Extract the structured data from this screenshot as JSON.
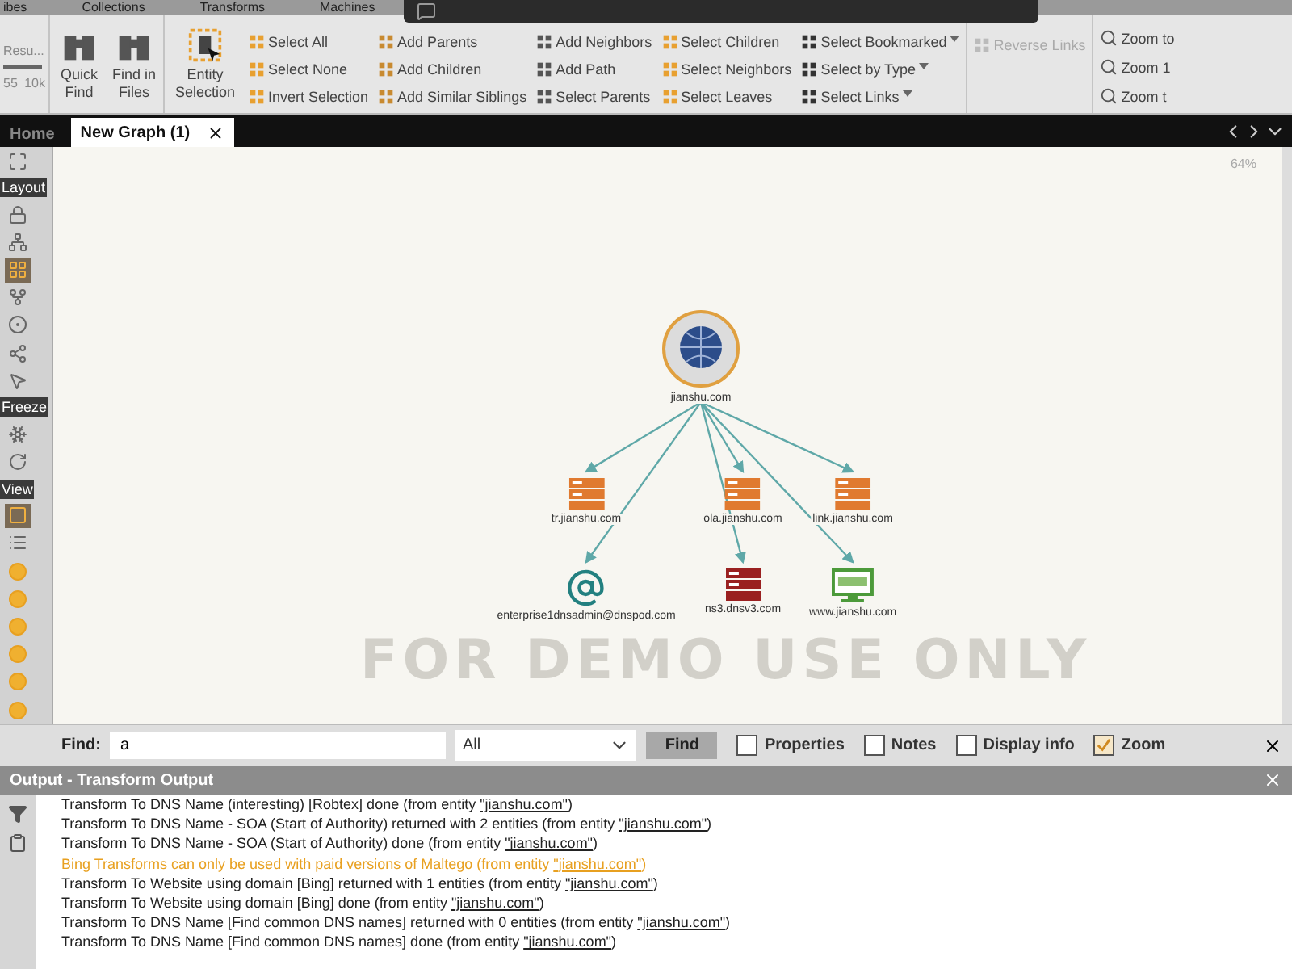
{
  "menu_tabs": [
    "ibes",
    "Collections",
    "Transforms",
    "Machines"
  ],
  "ribbon": {
    "slider_label": "Resu...",
    "ticks": [
      "55",
      "10k"
    ],
    "big_buttons": [
      {
        "label": "Quick Find"
      },
      {
        "label": "Find in Files"
      },
      {
        "label": "Entity Selection"
      }
    ],
    "columns": [
      {
        "items": [
          {
            "label": "Select All"
          },
          {
            "label": "Select None"
          },
          {
            "label": "Invert Selection"
          }
        ]
      },
      {
        "items": [
          {
            "label": "Add Parents"
          },
          {
            "label": "Add Children"
          },
          {
            "label": "Add Similar Siblings"
          }
        ]
      },
      {
        "items": [
          {
            "label": "Add Neighbors"
          },
          {
            "label": "Add Path"
          },
          {
            "label": "Select Parents"
          }
        ]
      },
      {
        "items": [
          {
            "label": "Select Children"
          },
          {
            "label": "Select Neighbors"
          },
          {
            "label": "Select Leaves"
          }
        ]
      },
      {
        "items": [
          {
            "label": "Select Bookmarked",
            "dropdown": true
          },
          {
            "label": "Select by Type",
            "dropdown": true
          },
          {
            "label": "Select Links",
            "dropdown": true
          }
        ]
      },
      {
        "items": [
          {
            "label": "Reverse Links",
            "disabled": true
          }
        ]
      }
    ],
    "zoom_items": [
      "Zoom to",
      "Zoom 1",
      "Zoom t"
    ]
  },
  "doc_tabs": [
    {
      "label": "Home",
      "selected": false
    },
    {
      "label": "New Graph (1)",
      "selected": true
    }
  ],
  "sidebar": [
    {
      "title": "Layout",
      "items": [
        {
          "selected": false
        },
        {
          "selected": false
        },
        {
          "selected": true
        },
        {
          "selected": false
        },
        {
          "selected": false
        },
        {
          "selected": false
        },
        {
          "selected": false
        }
      ]
    },
    {
      "title": "Freeze",
      "items": [
        {
          "selected": false
        },
        {
          "selected": false
        }
      ]
    },
    {
      "title": "View",
      "items": [
        {
          "selected": true
        },
        {
          "selected": false
        },
        {
          "selected": false
        },
        {
          "selected": false
        },
        {
          "selected": false
        },
        {
          "selected": false
        },
        {
          "selected": false
        },
        {
          "selected": false
        }
      ]
    }
  ],
  "graph": {
    "zoom_level": "64%",
    "watermark": "FOR DEMO USE ONLY",
    "root": {
      "label": "jianshu.com",
      "kind": "domain"
    },
    "children": [
      {
        "label": "tr.jianshu.com",
        "kind": "dns"
      },
      {
        "label": "ola.jianshu.com",
        "kind": "dns"
      },
      {
        "label": "link.jianshu.com",
        "kind": "dns"
      },
      {
        "label": "enterprise1dnsadmin@dnspod.com",
        "kind": "email"
      },
      {
        "label": "ns3.dnsv3.com",
        "kind": "ns"
      },
      {
        "label": "www.jianshu.com",
        "kind": "website"
      }
    ]
  },
  "find_bar": {
    "label": "Find:",
    "value": "a",
    "scope": "All",
    "button": "Find",
    "options": [
      {
        "label": "Properties",
        "checked": false
      },
      {
        "label": "Notes",
        "checked": false
      },
      {
        "label": "Display info",
        "checked": false
      },
      {
        "label": "Zoom",
        "checked": true
      }
    ]
  },
  "output": {
    "title": "Output - Transform Output",
    "lines": [
      {
        "kind": "info",
        "text": "Transform To DNS Name (interesting) [Robtex] done (from entity ",
        "entity": "\"jianshu.com\"",
        "end": ")"
      },
      {
        "kind": "info",
        "text": "Transform To DNS Name - SOA (Start of Authority) returned with 2 entities (from entity ",
        "entity": "\"jianshu.com\"",
        "end": ")"
      },
      {
        "kind": "info",
        "text": "Transform To DNS Name - SOA (Start of Authority) done (from entity ",
        "entity": "\"jianshu.com\"",
        "end": ")"
      },
      {
        "kind": "warning",
        "text": "Bing Transforms can only be used with paid versions of Maltego (from entity ",
        "entity": "\"jianshu.com\"",
        "end": ")"
      },
      {
        "kind": "info",
        "text": "Transform To Website using domain [Bing] returned with 1 entities (from entity ",
        "entity": "\"jianshu.com\"",
        "end": ")"
      },
      {
        "kind": "info",
        "text": "Transform To Website using domain [Bing] done (from entity ",
        "entity": "\"jianshu.com\"",
        "end": ")"
      },
      {
        "kind": "info",
        "text": "Transform To DNS Name [Find common DNS names] returned with 0 entities (from entity ",
        "entity": "\"jianshu.com\"",
        "end": ")"
      },
      {
        "kind": "info",
        "text": "Transform To DNS Name [Find common DNS names] done (from entity ",
        "entity": "\"jianshu.com\"",
        "end": ")"
      }
    ]
  }
}
